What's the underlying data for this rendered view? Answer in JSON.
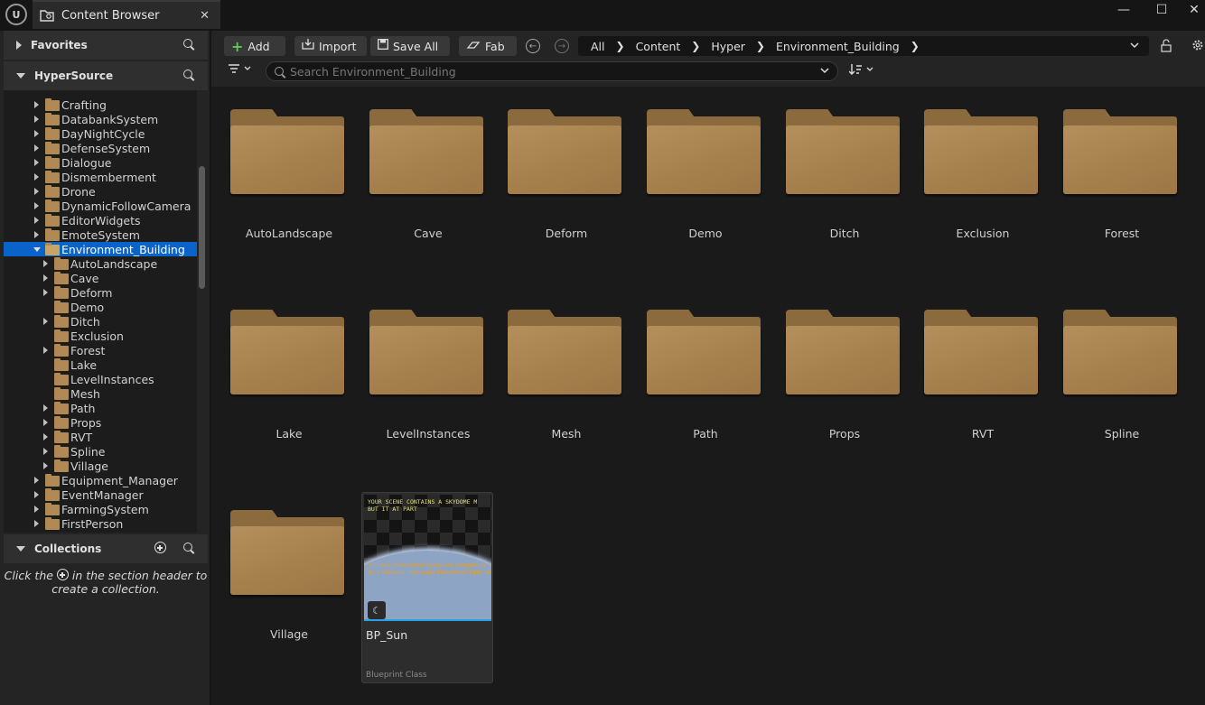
{
  "window": {
    "logo": "U",
    "tab_title": "Content Browser",
    "close_glyph": "✕",
    "minimize_glyph": "—",
    "maximize_glyph": "☐",
    "win_close_glyph": "✕"
  },
  "left": {
    "favorites": "Favorites",
    "source": "HyperSource",
    "collections": "Collections",
    "collections_msg_a": "Click the",
    "collections_msg_b": "in the section header to create a collection.",
    "tree": [
      {
        "label": "Crafting",
        "depth": 0,
        "arrow": "right"
      },
      {
        "label": "DatabankSystem",
        "depth": 0,
        "arrow": "right"
      },
      {
        "label": "DayNightCycle",
        "depth": 0,
        "arrow": "right"
      },
      {
        "label": "DefenseSystem",
        "depth": 0,
        "arrow": "right"
      },
      {
        "label": "Dialogue",
        "depth": 0,
        "arrow": "right"
      },
      {
        "label": "Dismemberment",
        "depth": 0,
        "arrow": "right"
      },
      {
        "label": "Drone",
        "depth": 0,
        "arrow": "right"
      },
      {
        "label": "DynamicFollowCamera",
        "depth": 0,
        "arrow": "right"
      },
      {
        "label": "EditorWidgets",
        "depth": 0,
        "arrow": "right"
      },
      {
        "label": "EmoteSystem",
        "depth": 0,
        "arrow": "right"
      },
      {
        "label": "Environment_Building",
        "depth": 0,
        "arrow": "down",
        "selected": true
      },
      {
        "label": "AutoLandscape",
        "depth": 1,
        "arrow": "right"
      },
      {
        "label": "Cave",
        "depth": 1,
        "arrow": "right"
      },
      {
        "label": "Deform",
        "depth": 1,
        "arrow": "right"
      },
      {
        "label": "Demo",
        "depth": 1,
        "arrow": "none"
      },
      {
        "label": "Ditch",
        "depth": 1,
        "arrow": "right"
      },
      {
        "label": "Exclusion",
        "depth": 1,
        "arrow": "none"
      },
      {
        "label": "Forest",
        "depth": 1,
        "arrow": "right"
      },
      {
        "label": "Lake",
        "depth": 1,
        "arrow": "none"
      },
      {
        "label": "LevelInstances",
        "depth": 1,
        "arrow": "none"
      },
      {
        "label": "Mesh",
        "depth": 1,
        "arrow": "none"
      },
      {
        "label": "Path",
        "depth": 1,
        "arrow": "right"
      },
      {
        "label": "Props",
        "depth": 1,
        "arrow": "right"
      },
      {
        "label": "RVT",
        "depth": 1,
        "arrow": "right"
      },
      {
        "label": "Spline",
        "depth": 1,
        "arrow": "right"
      },
      {
        "label": "Village",
        "depth": 1,
        "arrow": "right"
      },
      {
        "label": "Equipment_Manager",
        "depth": 0,
        "arrow": "right"
      },
      {
        "label": "EventManager",
        "depth": 0,
        "arrow": "right"
      },
      {
        "label": "FarmingSystem",
        "depth": 0,
        "arrow": "right"
      },
      {
        "label": "FirstPerson",
        "depth": 0,
        "arrow": "right"
      }
    ]
  },
  "toolbar": {
    "add": "Add",
    "import": "Import",
    "save_all": "Save All",
    "fab": "Fab",
    "breadcrumb": [
      "All",
      "Content",
      "Hyper",
      "Environment_Building"
    ]
  },
  "search": {
    "placeholder": "Search Environment_Building"
  },
  "folders": [
    "AutoLandscape",
    "Cave",
    "Deform",
    "Demo",
    "Ditch",
    "Exclusion",
    "Forest",
    "Lake",
    "LevelInstances",
    "Mesh",
    "Path",
    "Props",
    "RVT",
    "Spline",
    "Village"
  ],
  "asset": {
    "name": "BP_Sun",
    "type": "Blueprint Class",
    "thumb_line1": "YOUR SCENE CONTAINS A SKYDOME M",
    "thumb_line2": "BUT IT          AT PART",
    "thumb_line3": "Multiple directional lights are competing to",
    "thumb_line4": "As a fallback, the main directional light will"
  },
  "colors": {
    "selection": "#0a63c9",
    "folder": "#b08a52",
    "thumb_border": "#2aa0e6"
  }
}
